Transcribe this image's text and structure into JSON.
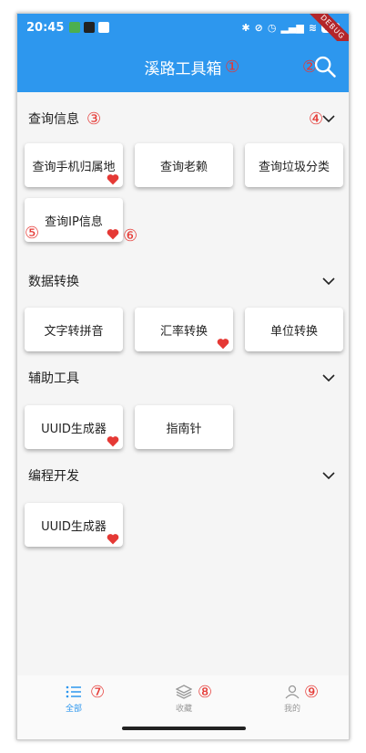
{
  "status_bar": {
    "time": "20:45",
    "battery": "94"
  },
  "debug_banner": "DEBUG",
  "app_bar": {
    "title": "溪路工具箱"
  },
  "markers": [
    "①",
    "②",
    "③",
    "④",
    "⑤",
    "⑥",
    "⑦",
    "⑧",
    "⑨"
  ],
  "sections": [
    {
      "title": "查询信息",
      "items": [
        {
          "label": "查询手机归属地",
          "favorite": true
        },
        {
          "label": "查询老赖",
          "favorite": false
        },
        {
          "label": "查询垃圾分类",
          "favorite": false
        },
        {
          "label": "查询IP信息",
          "favorite": true
        }
      ]
    },
    {
      "title": "数据转换",
      "items": [
        {
          "label": "文字转拼音",
          "favorite": false
        },
        {
          "label": "汇率转换",
          "favorite": true
        },
        {
          "label": "单位转换",
          "favorite": false
        }
      ]
    },
    {
      "title": "辅助工具",
      "items": [
        {
          "label": "UUID生成器",
          "favorite": true
        },
        {
          "label": "指南针",
          "favorite": false
        }
      ]
    },
    {
      "title": "编程开发",
      "items": [
        {
          "label": "UUID生成器",
          "favorite": true
        }
      ]
    }
  ],
  "bottom_nav": [
    {
      "label": "全部",
      "icon": "list-icon",
      "active": true
    },
    {
      "label": "收藏",
      "icon": "layers-icon",
      "active": false
    },
    {
      "label": "我的",
      "icon": "person-icon",
      "active": false
    }
  ],
  "colors": {
    "primary": "#2d97ee",
    "heart": "#e53935",
    "annotation": "#e53935"
  }
}
